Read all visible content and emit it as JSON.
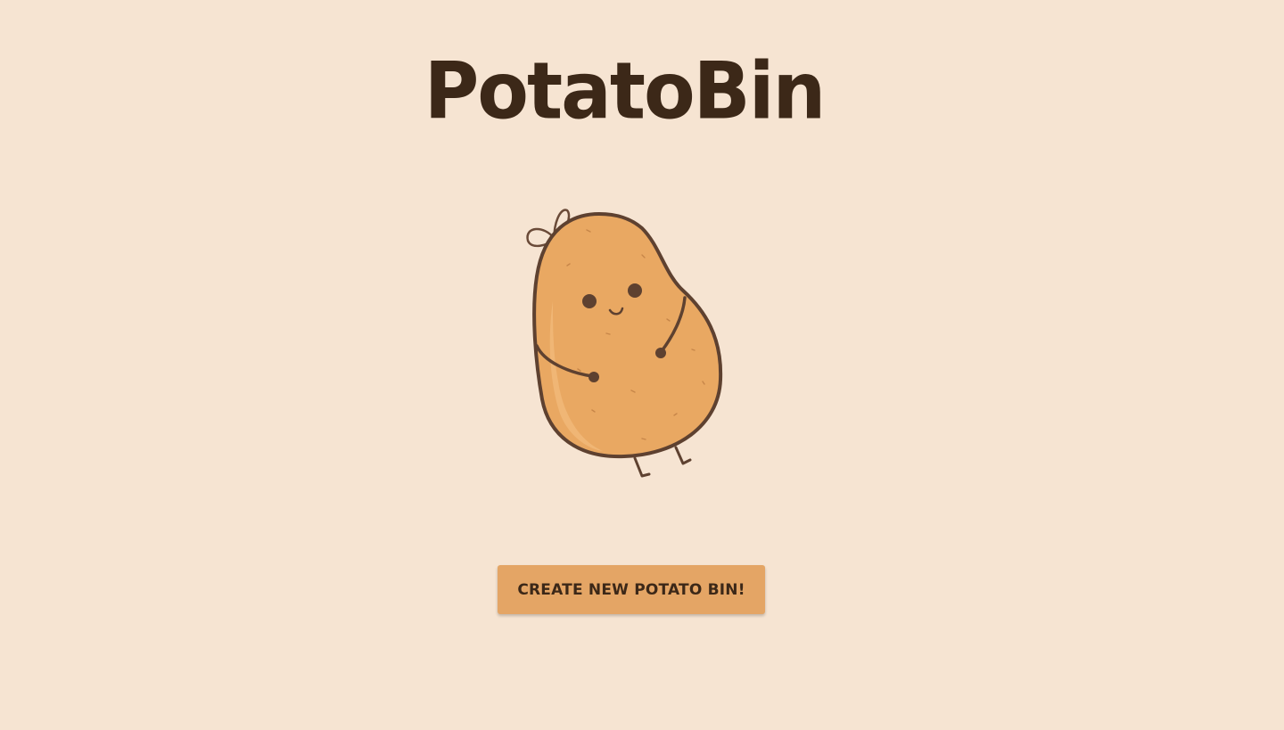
{
  "app": {
    "title": "PotatoBin"
  },
  "colors": {
    "background": "#f6e4d2",
    "title_text": "#3c2818",
    "button_bg": "#e4a565",
    "potato_body": "#e9a862",
    "potato_outline": "#5e4130"
  },
  "mascot": {
    "icon": "potato-mascot-icon"
  },
  "actions": {
    "create_label": "CREATE NEW POTATO BIN!"
  }
}
